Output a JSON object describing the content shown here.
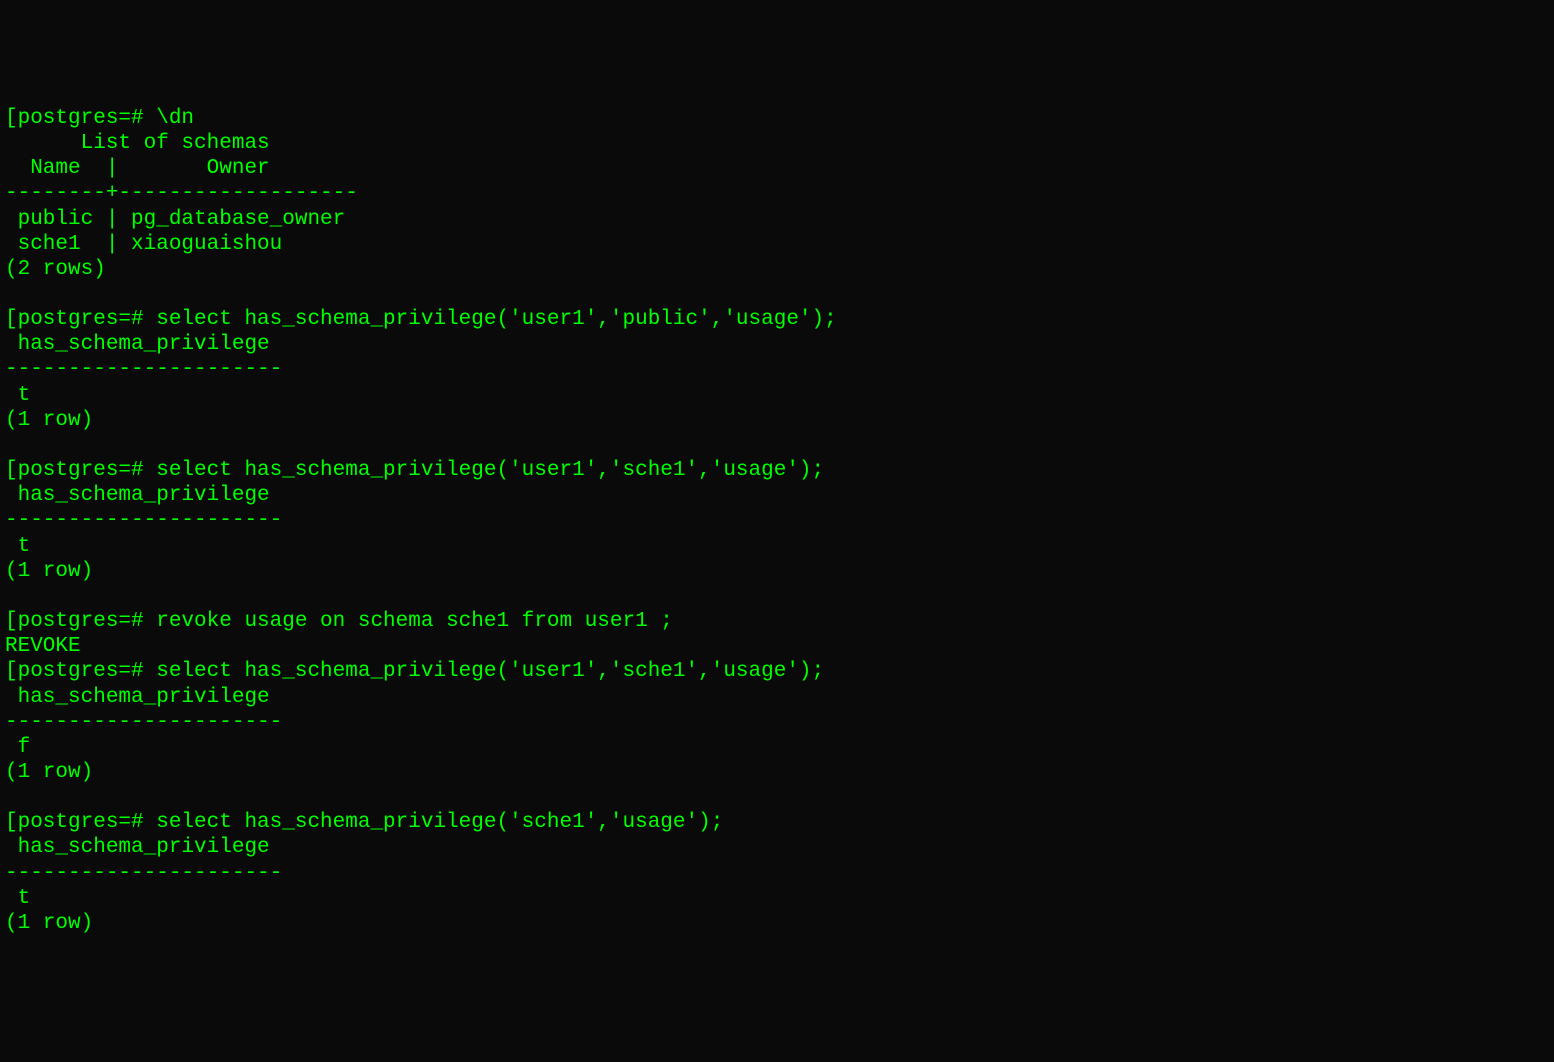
{
  "terminal": {
    "lines": [
      "[postgres=# \\dn",
      "      List of schemas",
      "  Name  |       Owner",
      "--------+-------------------",
      " public | pg_database_owner",
      " sche1  | xiaoguaishou",
      "(2 rows)",
      "",
      "[postgres=# select has_schema_privilege('user1','public','usage');",
      " has_schema_privilege",
      "----------------------",
      " t",
      "(1 row)",
      "",
      "[postgres=# select has_schema_privilege('user1','sche1','usage');",
      " has_schema_privilege",
      "----------------------",
      " t",
      "(1 row)",
      "",
      "[postgres=# revoke usage on schema sche1 from user1 ;",
      "REVOKE",
      "[postgres=# select has_schema_privilege('user1','sche1','usage');",
      " has_schema_privilege",
      "----------------------",
      " f",
      "(1 row)",
      "",
      "[postgres=# select has_schema_privilege('sche1','usage');",
      " has_schema_privilege",
      "----------------------",
      " t",
      "(1 row)"
    ]
  }
}
